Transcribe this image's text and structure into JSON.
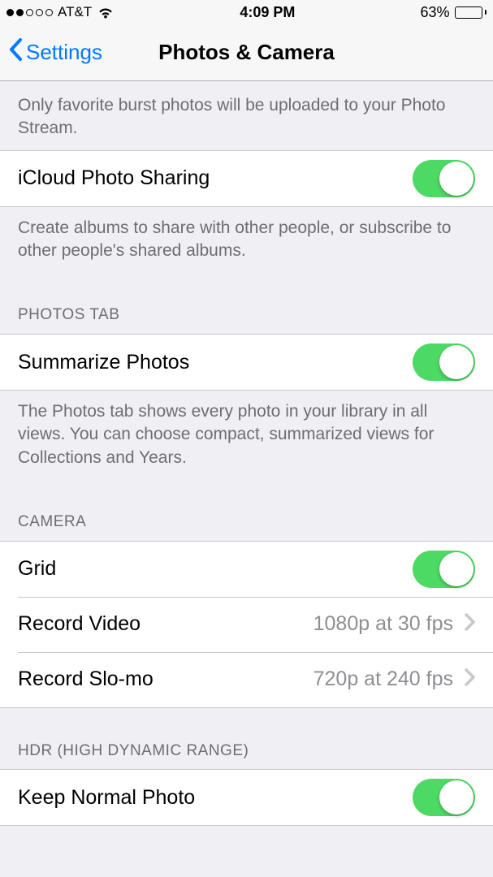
{
  "status": {
    "carrier": "AT&T",
    "time": "4:09 PM",
    "battery_pct": "63%",
    "battery_level": 63
  },
  "nav": {
    "back_label": "Settings",
    "title": "Photos & Camera"
  },
  "footers": {
    "burst": "Only favorite burst photos will be uploaded to your Photo Stream.",
    "icloud_sharing": "Create albums to share with other people, or subscribe to other people's shared albums.",
    "summarize": "The Photos tab shows every photo in your library in all views. You can choose compact, summarized views for Collections and Years."
  },
  "headers": {
    "photos_tab": "Photos Tab",
    "camera": "Camera",
    "hdr": "HDR (High Dynamic Range)"
  },
  "cells": {
    "icloud_sharing": "iCloud Photo Sharing",
    "summarize": "Summarize Photos",
    "grid": "Grid",
    "record_video": "Record Video",
    "record_video_value": "1080p at 30 fps",
    "record_slomo": "Record Slo-mo",
    "record_slomo_value": "720p at 240 fps",
    "keep_normal": "Keep Normal Photo"
  }
}
